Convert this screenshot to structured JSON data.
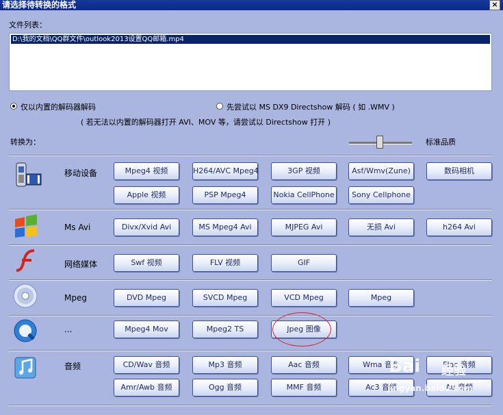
{
  "window": {
    "title": "请选择待转换的格式",
    "close": "×"
  },
  "filelist": {
    "label": "文件列表：",
    "items": [
      "D:\\我的文档\\QQ群文件\\outlook2013设置QQ邮箱.mp4"
    ]
  },
  "decode": {
    "option1": "仅以内置的解码器解码",
    "option2": "先尝试以 MS DX9 Directshow 解码 ( 如 .WMV )",
    "note": "( 若无法以内置的解码器打开 AVI、MOV 等，请尝试以 Directshow 打开 )",
    "selected": 1
  },
  "convert": {
    "label": "转换为：",
    "quality_label": "标准品质",
    "quality_level": 0.5
  },
  "rows": [
    {
      "name": "移动设备",
      "icon": "mobile-phone-icon",
      "buttons": [
        "Mpeg4 视频",
        "H264/AVC Mpeg4",
        "3GP 视频",
        "Asf/Wmv(Zune)",
        "数码相机",
        "Apple 视频",
        "PSP Mpeg4",
        "Nokia CellPhone",
        "Sony Cellphone"
      ]
    },
    {
      "name": "Ms Avi",
      "icon": "windows-flag-icon",
      "buttons": [
        "Divx/Xvid Avi",
        "MS Mpeg4 Avi",
        "MJPEG Avi",
        "无损 Avi",
        "h264 Avi"
      ]
    },
    {
      "name": "网络媒体",
      "icon": "flash-icon",
      "buttons": [
        "Swf 视频",
        "FLV 视频",
        "GIF"
      ]
    },
    {
      "name": "Mpeg",
      "icon": "disc-icon",
      "buttons": [
        "DVD Mpeg",
        "SVCD Mpeg",
        "VCD Mpeg",
        "Mpeg"
      ]
    },
    {
      "name": "...",
      "icon": "quicktime-icon",
      "buttons": [
        "Mpeg4 Mov",
        "Mpeg2 TS",
        "Jpeg 图像"
      ]
    },
    {
      "name": "音频",
      "icon": "music-note-icon",
      "buttons": [
        "CD/Wav 音频",
        "Mp3 音频",
        "Aac 音频",
        "Wma 音频",
        "Flac 音频",
        "Amr/Awb 音频",
        "Ogg 音频",
        "MMF 音频",
        "Ac3 音频",
        "Au 音频"
      ]
    }
  ],
  "watermark": {
    "logo": "Bai",
    "logo2": "经验",
    "url": "jingyan.baidu.com"
  },
  "colors": {
    "titlebar": "#0b2a8a",
    "background": "#aab5e0",
    "highlight_circle": "#d8222a"
  }
}
